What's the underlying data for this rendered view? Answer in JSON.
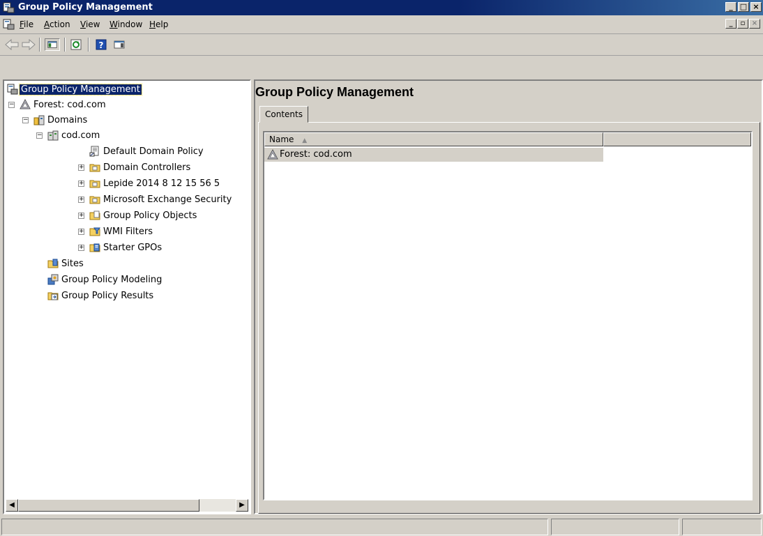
{
  "window": {
    "title": "Group Policy Management"
  },
  "menu": {
    "items": [
      {
        "label": "File",
        "accel": "F",
        "rest": "ile"
      },
      {
        "label": "Action",
        "accel": "A",
        "rest": "ction"
      },
      {
        "label": "View",
        "accel": "V",
        "rest": "iew"
      },
      {
        "label": "Window",
        "accel": "W",
        "rest": "indow"
      },
      {
        "label": "Help",
        "accel": "H",
        "rest": "elp"
      }
    ]
  },
  "toolbar": {
    "buttons": [
      "back-arrow-icon",
      "forward-arrow-icon",
      "show-hide-console-tree-icon",
      "refresh-icon",
      "help-icon",
      "show-action-pane-icon"
    ]
  },
  "tree": {
    "root": "Group Policy Management",
    "forest": "Forest: cod.com",
    "domains": "Domains",
    "domain": "cod.com",
    "children": [
      "Default Domain Policy",
      "Domain Controllers",
      "Lepide 2014 8 12 15 56 5",
      "Microsoft Exchange Security",
      "Group Policy Objects",
      "WMI Filters",
      "Starter GPOs"
    ],
    "sites": "Sites",
    "modeling": "Group Policy Modeling",
    "results": "Group Policy Results"
  },
  "details": {
    "title": "Group Policy Management",
    "tab": "Contents",
    "column_name": "Name",
    "rows": [
      "Forest: cod.com"
    ]
  },
  "colors": {
    "titlebar": "#0a246a",
    "face": "#d4d0c8"
  }
}
